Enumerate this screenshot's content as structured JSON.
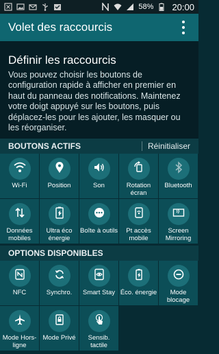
{
  "status_bar": {
    "battery": "58%",
    "time": "20:00"
  },
  "app_bar": {
    "title": "Volet des raccourcis"
  },
  "info": {
    "title": "Définir les raccourcis",
    "body": "Vous pouvez choisir les boutons de configuration rapide à afficher en premier en haut du panneau des notifications. Maintenez votre doigt appuyé sur les boutons, puis déplacez-les pour les ajouter, les masquer ou les réorganiser."
  },
  "active": {
    "header": "BOUTONS ACTIFS",
    "reset": "Réinitialiser",
    "tiles": [
      {
        "label": "Wi-Fi",
        "icon": "wifi-icon"
      },
      {
        "label": "Position",
        "icon": "location-icon"
      },
      {
        "label": "Son",
        "icon": "sound-icon"
      },
      {
        "label": "Rotation écran",
        "icon": "rotation-icon"
      },
      {
        "label": "Bluetooth",
        "icon": "bluetooth-icon"
      },
      {
        "label": "Données mobiles",
        "icon": "mobile-data-icon"
      },
      {
        "label": "Ultra éco énergie",
        "icon": "ultra-power-saving-icon"
      },
      {
        "label": "Boîte à outils",
        "icon": "toolbox-icon"
      },
      {
        "label": "Pt accès mobile",
        "icon": "hotspot-icon"
      },
      {
        "label": "Screen Mirroring",
        "icon": "screen-mirroring-icon"
      }
    ]
  },
  "available": {
    "header": "OPTIONS DISPONIBLES",
    "tiles": [
      {
        "label": "NFC",
        "icon": "nfc-icon"
      },
      {
        "label": "Synchro.",
        "icon": "sync-icon"
      },
      {
        "label": "Smart Stay",
        "icon": "smart-stay-icon"
      },
      {
        "label": "Éco. énergie",
        "icon": "power-saving-icon"
      },
      {
        "label": "Mode blocage",
        "icon": "blocking-mode-icon"
      },
      {
        "label": "Mode Hors-ligne",
        "icon": "airplane-mode-icon"
      },
      {
        "label": "Mode Privé",
        "icon": "private-mode-icon"
      },
      {
        "label": "Sensib. tactile",
        "icon": "touch-sensitivity-icon"
      }
    ]
  }
}
